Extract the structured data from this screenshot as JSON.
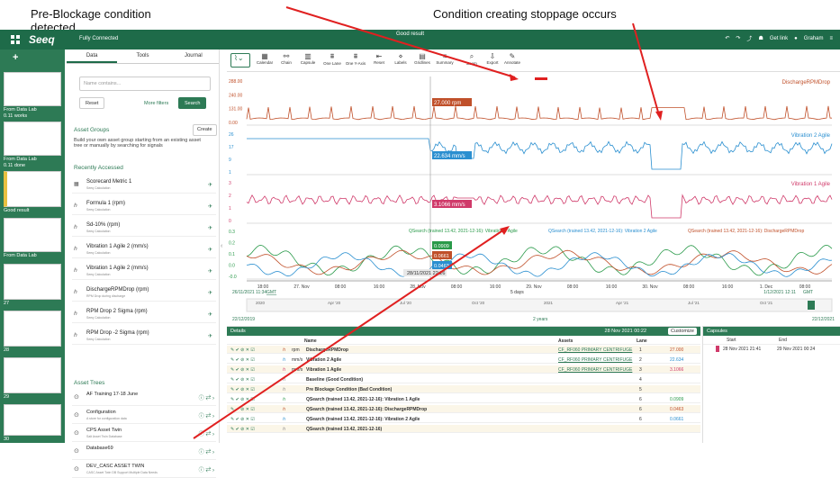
{
  "annotations": {
    "left_title": "Pre-Blockage condition\ndetected",
    "right_title": "Condition creating stoppage occurs"
  },
  "topbar": {
    "logo": "Seeq",
    "status": "Fully Connected",
    "window_title": "Good result",
    "get_link": "Get link",
    "user": "Graham"
  },
  "worksheets": [
    {
      "label": "From Data Lab",
      "sub": "0.11 works"
    },
    {
      "label": "From Data Lab",
      "sub": "0.11 done"
    },
    {
      "label": "Good result",
      "sub": ""
    },
    {
      "label": "From Data Lab",
      "sub": ""
    },
    {
      "label": "27",
      "sub": ""
    },
    {
      "label": "28",
      "sub": ""
    },
    {
      "label": "29",
      "sub": ""
    },
    {
      "label": "30",
      "sub": ""
    }
  ],
  "panel": {
    "tabs": [
      "Data",
      "Tools",
      "Journal"
    ],
    "search_placeholder": "Name contains...",
    "reset": "Reset",
    "more_filters": "More filters",
    "search": "Search",
    "asset_groups_title": "Asset Groups",
    "create": "Create",
    "asset_groups_text": "Build your own asset group starting from an existing asset tree or manually by searching for signals",
    "recent_title": "Recently Accessed",
    "recent": [
      {
        "name": "Scorecard Metric 1",
        "sub": "Seeq Calculation"
      },
      {
        "name": "Formula 1 (rpm)",
        "sub": "Seeq Calculation"
      },
      {
        "name": "Sd-10% (rpm)",
        "sub": "Seeq Calculation"
      },
      {
        "name": "Vibration 1 Agile 2 (mm/s)",
        "sub": "Seeq Calculation"
      },
      {
        "name": "Vibration 1 Agile 2 (mm/s)",
        "sub": "Seeq Calculation"
      },
      {
        "name": "DischargeRPMDrop (rpm)",
        "sub": "RPM Drop during discharge"
      },
      {
        "name": "RPM Drop 2 Sigma (rpm)",
        "sub": "Seeq Calculation"
      },
      {
        "name": "RPM Drop -2 Sigma (rpm)",
        "sub": "Seeq Calculation"
      }
    ],
    "trees_title": "Asset Trees",
    "trees": [
      {
        "name": "AF Training 17-18 June",
        "sub": ""
      },
      {
        "name": "Configuration",
        "sub": "A store for configuration data"
      },
      {
        "name": "CPS Asset Twin",
        "sub": "Salt Asset Twin Database"
      },
      {
        "name": "Database69",
        "sub": ""
      },
      {
        "name": "DEV_CASC ASSET TWIN",
        "sub": "CASC Asset Twin DB Support Multiple Data Needs"
      }
    ]
  },
  "toolbar": {
    "buttons": [
      "Calendar",
      "Chain",
      "Capsule",
      "One Lane",
      "One Y-Axis",
      "Reset",
      "Labels",
      "Gridlines",
      "Summary",
      "Zoom",
      "Export",
      "Annotate"
    ]
  },
  "chart": {
    "lanes": [
      {
        "name": "DischargeRPMDrop",
        "color": "#c0502a",
        "yticks": [
          "288.00",
          "240.00",
          "131.00",
          "0.00"
        ],
        "readout": "27.000 rpm"
      },
      {
        "name": "Vibration 2 Agile",
        "color": "#2a8fd0",
        "yticks": [
          "26",
          "17",
          "9",
          "1"
        ],
        "readout": "22.634 mm/s"
      },
      {
        "name": "Vibration 1 Agile",
        "color": "#d03a6a",
        "yticks": [
          "3",
          "2",
          "1",
          "0"
        ],
        "readout": "3.1066 mm/s"
      },
      {
        "name": "QSearch",
        "color": "#2a9a4a",
        "yticks": [
          "0.3",
          "0.2",
          "0.1",
          "0.0",
          "-0.0"
        ],
        "readout": ""
      }
    ],
    "legend_q": [
      "QSearch (trained 13.42, 2021-12-16): Vibration 1 Agile",
      "QSearch (trained 13.42, 2021-12-16): Vibration 2 Agile",
      "QSearch (trained 13.42, 2021-12-16): DischargeRPMDrop"
    ],
    "q_values": [
      "0.0909",
      "0.0661",
      "0.0463"
    ],
    "xticks": [
      "18:00",
      "27. Nov",
      "08:00",
      "16:00",
      "28. Nov",
      "08:00",
      "16:00",
      "29. Nov",
      "08:00",
      "16:00",
      "30. Nov",
      "08:00",
      "16:00",
      "1. Dec",
      "08:00"
    ],
    "cursor_time": "28/11/2021 22:26",
    "start": "26/11/2021 11:34",
    "start_tz": "GMT",
    "end": "1/12/2021 12:11",
    "end_tz": "GMT",
    "nav": "5 days",
    "overview_start": "22/12/2019",
    "overview_end": "22/12/2021",
    "overview_span": "2 years",
    "overview_ticks": [
      "2020",
      "Apr '20",
      "Jul '20",
      "Oct '20",
      "2021",
      "Apr '21",
      "Jul '21",
      "Oct '21"
    ]
  },
  "details": {
    "title": "Details",
    "date": "28 Nov 2021 00:22",
    "customize": "Customize",
    "cols": [
      "Name",
      "Assets",
      "Lane"
    ],
    "rows": [
      {
        "name": "DischargeRPMDrop",
        "unit": "rpm",
        "asset": "CF_RF060 PRIMARY CENTRIFUGE",
        "lane": "1",
        "value": "27.000",
        "color": "#c0502a"
      },
      {
        "name": "Vibration 2 Agile",
        "unit": "mm/s",
        "asset": "CF_RF060 PRIMARY CENTRIFUGE",
        "lane": "2",
        "value": "22.634",
        "color": "#2a8fd0"
      },
      {
        "name": "Vibration 1 Agile",
        "unit": "mm/s",
        "asset": "CF_RF060 PRIMARY CENTRIFUGE",
        "lane": "3",
        "value": "3.1066",
        "color": "#d03a6a"
      },
      {
        "name": "Baseline (Good Condition)",
        "unit": "",
        "asset": "",
        "lane": "4",
        "value": "",
        "color": "#888"
      },
      {
        "name": "Pre Blockage Condition (Bad Condition)",
        "unit": "",
        "asset": "",
        "lane": "5",
        "value": "",
        "color": "#888"
      },
      {
        "name": "QSearch (trained 13.42, 2021-12-16): Vibration 1 Agile",
        "unit": "",
        "asset": "",
        "lane": "6",
        "value": "0.0909",
        "color": "#2a9a4a"
      },
      {
        "name": "QSearch (trained 13.42, 2021-12-16): DischargeRPMDrop",
        "unit": "",
        "asset": "",
        "lane": "6",
        "value": "0.0463",
        "color": "#c0502a"
      },
      {
        "name": "QSearch (trained 13.42, 2021-12-16): Vibration 2 Agile",
        "unit": "",
        "asset": "",
        "lane": "6",
        "value": "0.0661",
        "color": "#2a8fd0"
      },
      {
        "name": "QSearch (trained 13.42, 2021-12-16)",
        "unit": "",
        "asset": "",
        "lane": "",
        "value": "",
        "color": "#888"
      }
    ]
  },
  "capsules": {
    "title": "Capsules",
    "start_col": "Start",
    "end_col": "End",
    "row_start": "28 Nov 2021 21:41",
    "row_end": "29 Nov 2021 00:24"
  }
}
